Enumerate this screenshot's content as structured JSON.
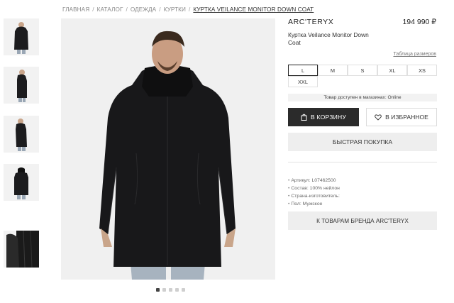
{
  "breadcrumb": {
    "items": [
      "ГЛАВНАЯ",
      "КАТАЛОГ",
      "ОДЕЖДА",
      "КУРТКИ"
    ],
    "current": "КУРТКА VEILANCE MONITOR DOWN COAT",
    "separator": "/"
  },
  "gallery": {
    "thumbnails": [
      "front",
      "side",
      "side-2",
      "back",
      "detail"
    ],
    "dots": 5,
    "active_dot": 0
  },
  "product": {
    "brand": "ARC'TERYX",
    "price": "194 990 ₽",
    "name": "Куртка Veilance Monitor Down Coat",
    "size_chart": "Таблица размеров",
    "sizes": [
      "L",
      "M",
      "S",
      "XL",
      "XS",
      "XXL"
    ],
    "selected_size": "L",
    "availability": "Товар доступен в магазинах: Online",
    "add_to_cart": "В КОРЗИНУ",
    "add_to_favorites": "В ИЗБРАННОЕ",
    "quick_buy": "БЫСТРАЯ ПОКУПКА",
    "specs": [
      "Артикул: L07462500",
      "Состав: 100% нейлон",
      "Страна-изготовитель:",
      "Пол: Мужское"
    ],
    "brand_link": "К ТОВАРАМ БРЕНДА ARC'TERYX"
  },
  "icons": {
    "cart": "bag-icon",
    "favorite": "heart-icon"
  },
  "colors": {
    "primary_button": "#2b2b2b",
    "secondary_button": "#eeeeee",
    "selected_border": "#222222"
  }
}
